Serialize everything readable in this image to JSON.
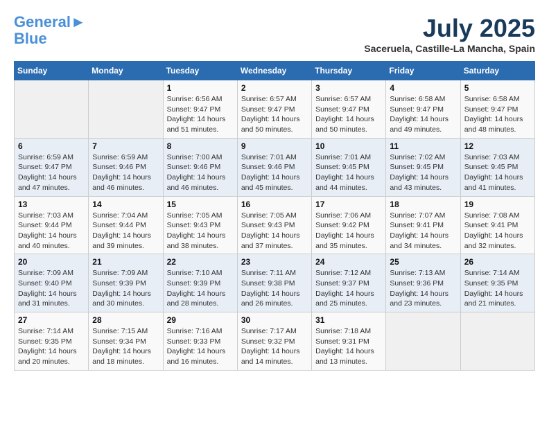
{
  "logo": {
    "line1": "General",
    "line2": "Blue"
  },
  "title": "July 2025",
  "subtitle": "Saceruela, Castille-La Mancha, Spain",
  "headers": [
    "Sunday",
    "Monday",
    "Tuesday",
    "Wednesday",
    "Thursday",
    "Friday",
    "Saturday"
  ],
  "weeks": [
    [
      {
        "day": "",
        "info": ""
      },
      {
        "day": "",
        "info": ""
      },
      {
        "day": "1",
        "info": "Sunrise: 6:56 AM\nSunset: 9:47 PM\nDaylight: 14 hours and 51 minutes."
      },
      {
        "day": "2",
        "info": "Sunrise: 6:57 AM\nSunset: 9:47 PM\nDaylight: 14 hours and 50 minutes."
      },
      {
        "day": "3",
        "info": "Sunrise: 6:57 AM\nSunset: 9:47 PM\nDaylight: 14 hours and 50 minutes."
      },
      {
        "day": "4",
        "info": "Sunrise: 6:58 AM\nSunset: 9:47 PM\nDaylight: 14 hours and 49 minutes."
      },
      {
        "day": "5",
        "info": "Sunrise: 6:58 AM\nSunset: 9:47 PM\nDaylight: 14 hours and 48 minutes."
      }
    ],
    [
      {
        "day": "6",
        "info": "Sunrise: 6:59 AM\nSunset: 9:47 PM\nDaylight: 14 hours and 47 minutes."
      },
      {
        "day": "7",
        "info": "Sunrise: 6:59 AM\nSunset: 9:46 PM\nDaylight: 14 hours and 46 minutes."
      },
      {
        "day": "8",
        "info": "Sunrise: 7:00 AM\nSunset: 9:46 PM\nDaylight: 14 hours and 46 minutes."
      },
      {
        "day": "9",
        "info": "Sunrise: 7:01 AM\nSunset: 9:46 PM\nDaylight: 14 hours and 45 minutes."
      },
      {
        "day": "10",
        "info": "Sunrise: 7:01 AM\nSunset: 9:45 PM\nDaylight: 14 hours and 44 minutes."
      },
      {
        "day": "11",
        "info": "Sunrise: 7:02 AM\nSunset: 9:45 PM\nDaylight: 14 hours and 43 minutes."
      },
      {
        "day": "12",
        "info": "Sunrise: 7:03 AM\nSunset: 9:45 PM\nDaylight: 14 hours and 41 minutes."
      }
    ],
    [
      {
        "day": "13",
        "info": "Sunrise: 7:03 AM\nSunset: 9:44 PM\nDaylight: 14 hours and 40 minutes."
      },
      {
        "day": "14",
        "info": "Sunrise: 7:04 AM\nSunset: 9:44 PM\nDaylight: 14 hours and 39 minutes."
      },
      {
        "day": "15",
        "info": "Sunrise: 7:05 AM\nSunset: 9:43 PM\nDaylight: 14 hours and 38 minutes."
      },
      {
        "day": "16",
        "info": "Sunrise: 7:05 AM\nSunset: 9:43 PM\nDaylight: 14 hours and 37 minutes."
      },
      {
        "day": "17",
        "info": "Sunrise: 7:06 AM\nSunset: 9:42 PM\nDaylight: 14 hours and 35 minutes."
      },
      {
        "day": "18",
        "info": "Sunrise: 7:07 AM\nSunset: 9:41 PM\nDaylight: 14 hours and 34 minutes."
      },
      {
        "day": "19",
        "info": "Sunrise: 7:08 AM\nSunset: 9:41 PM\nDaylight: 14 hours and 32 minutes."
      }
    ],
    [
      {
        "day": "20",
        "info": "Sunrise: 7:09 AM\nSunset: 9:40 PM\nDaylight: 14 hours and 31 minutes."
      },
      {
        "day": "21",
        "info": "Sunrise: 7:09 AM\nSunset: 9:39 PM\nDaylight: 14 hours and 30 minutes."
      },
      {
        "day": "22",
        "info": "Sunrise: 7:10 AM\nSunset: 9:39 PM\nDaylight: 14 hours and 28 minutes."
      },
      {
        "day": "23",
        "info": "Sunrise: 7:11 AM\nSunset: 9:38 PM\nDaylight: 14 hours and 26 minutes."
      },
      {
        "day": "24",
        "info": "Sunrise: 7:12 AM\nSunset: 9:37 PM\nDaylight: 14 hours and 25 minutes."
      },
      {
        "day": "25",
        "info": "Sunrise: 7:13 AM\nSunset: 9:36 PM\nDaylight: 14 hours and 23 minutes."
      },
      {
        "day": "26",
        "info": "Sunrise: 7:14 AM\nSunset: 9:35 PM\nDaylight: 14 hours and 21 minutes."
      }
    ],
    [
      {
        "day": "27",
        "info": "Sunrise: 7:14 AM\nSunset: 9:35 PM\nDaylight: 14 hours and 20 minutes."
      },
      {
        "day": "28",
        "info": "Sunrise: 7:15 AM\nSunset: 9:34 PM\nDaylight: 14 hours and 18 minutes."
      },
      {
        "day": "29",
        "info": "Sunrise: 7:16 AM\nSunset: 9:33 PM\nDaylight: 14 hours and 16 minutes."
      },
      {
        "day": "30",
        "info": "Sunrise: 7:17 AM\nSunset: 9:32 PM\nDaylight: 14 hours and 14 minutes."
      },
      {
        "day": "31",
        "info": "Sunrise: 7:18 AM\nSunset: 9:31 PM\nDaylight: 14 hours and 13 minutes."
      },
      {
        "day": "",
        "info": ""
      },
      {
        "day": "",
        "info": ""
      }
    ]
  ]
}
